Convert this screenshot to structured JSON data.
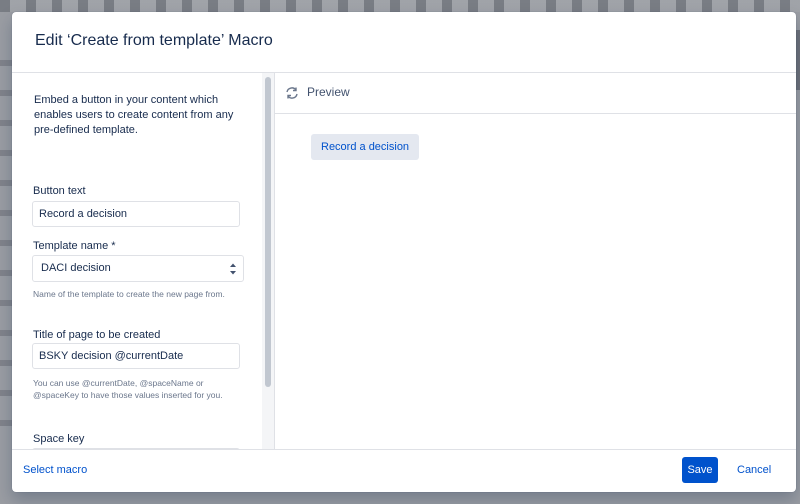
{
  "dialog": {
    "title": "Edit ‘Create from template’ Macro"
  },
  "form": {
    "intro": "Embed a button in your content which enables users to create content from any pre-defined template.",
    "button_text_label": "Button text",
    "button_text_value": "Record a decision",
    "template_name_label": "Template name *",
    "template_name_value": "DACI decision",
    "template_name_help": "Name of the template to create the new page from.",
    "page_title_label": "Title of page to be created",
    "page_title_value": "BSKY decision @currentDate",
    "page_title_help": "You can use @currentDate, @spaceName or @spaceKey to have those values inserted for you.",
    "space_key_label": "Space key"
  },
  "preview": {
    "title": "Preview",
    "button_label": "Record a decision"
  },
  "footer": {
    "select_macro": "Select macro",
    "save": "Save",
    "cancel": "Cancel"
  },
  "icons": {
    "preview": "refresh-icon",
    "select": "up-down-chevron-icon"
  },
  "colors": {
    "primary": "#0052cc",
    "text": "#172b4d",
    "border": "#dfe1e6"
  }
}
